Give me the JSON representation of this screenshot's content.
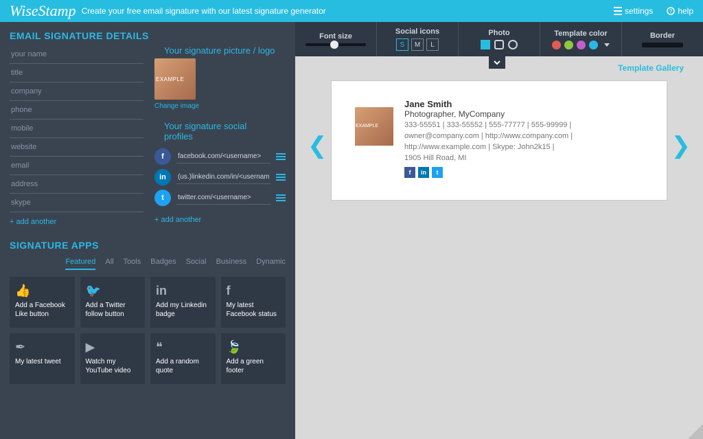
{
  "header": {
    "brand": "WiseStamp",
    "tagline": "Create your free email signature with our latest signature generator",
    "settings": "settings",
    "help": "help"
  },
  "details": {
    "title": "EMAIL SIGNATURE DETAILS",
    "pic_title": "Your signature picture / logo",
    "change_image": "Change image",
    "social_title": "Your signature social profiles",
    "add_another": "+ add another",
    "fields": {
      "name": "your name",
      "titlef": "title",
      "company": "company",
      "phone": "phone",
      "mobile": "mobile",
      "website": "website",
      "email": "email",
      "address": "address",
      "skype": "skype"
    },
    "socials": {
      "facebook": "facebook.com/<username>",
      "linkedin": "(us.)linkedin.com/in/<username>",
      "twitter": "twitter.com/<username>"
    }
  },
  "apps": {
    "title": "SIGNATURE APPS",
    "tabs": {
      "featured": "Featured",
      "all": "All",
      "tools": "Tools",
      "badges": "Badges",
      "social": "Social",
      "business": "Business",
      "dynamic": "Dynamic"
    },
    "cards": {
      "fb_like": "Add a Facebook Like button",
      "tw_follow": "Add a Twitter follow button",
      "li_badge": "Add my Linkedin badge",
      "fb_status": "My latest Facebook status",
      "tweet": "My latest tweet",
      "yt": "Watch my YouTube video",
      "quote": "Add a random quote",
      "green": "Add a green footer"
    }
  },
  "strip": {
    "font_size": "Font size",
    "social_icons": "Social icons",
    "photo": "Photo",
    "template_color": "Template color",
    "border": "Border",
    "sizes": {
      "s": "S",
      "m": "M",
      "l": "L"
    }
  },
  "colors": {
    "c1": "#e05b50",
    "c2": "#8fc741",
    "c3": "#c25fcc",
    "c4": "#2bb8e4"
  },
  "gallery": "Template Gallery",
  "preview": {
    "name": "Jane Smith",
    "title": "Photographer, MyCompany",
    "line1": "333-55551 | 333-55552 | 555-77777 | 555-99999 |",
    "line2": "owner@company.com | http://www.company.com |",
    "line3": "http://www.example.com | Skype: John2k15 |",
    "line4": "1905 Hill Road, MI"
  }
}
